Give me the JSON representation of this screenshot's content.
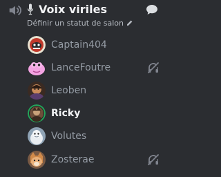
{
  "channel": {
    "name": "Voix viriles",
    "status_placeholder": "Définir un statut de salon"
  },
  "icons": {
    "speaker": "speaker-icon",
    "mic": "microphone-icon",
    "chat": "chat-bubble-icon",
    "edit": "pencil-icon",
    "deafened": "headphones-off-icon"
  },
  "users": [
    {
      "name": "Captain404",
      "speaking": false,
      "deafened": false
    },
    {
      "name": "LanceFoutre",
      "speaking": false,
      "deafened": true
    },
    {
      "name": "Leoben",
      "speaking": false,
      "deafened": false
    },
    {
      "name": "Ricky",
      "speaking": true,
      "deafened": false
    },
    {
      "name": "Volutes",
      "speaking": false,
      "deafened": false
    },
    {
      "name": "Zosterae",
      "speaking": false,
      "deafened": true
    }
  ],
  "colors": {
    "background": "#2b2d31",
    "speaking_ring": "#23a55a",
    "muted_text": "#949ba4",
    "active_text": "#f2f3f5"
  }
}
